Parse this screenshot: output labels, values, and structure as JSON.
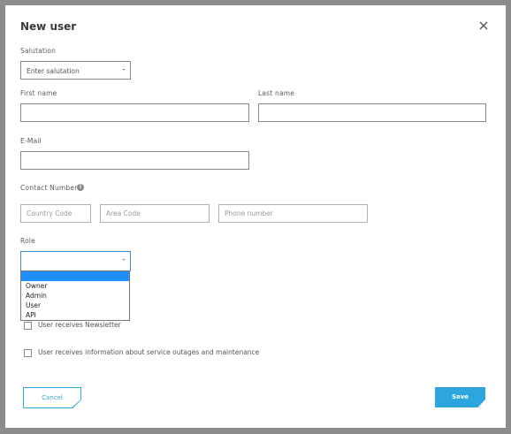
{
  "modal": {
    "title": "New user"
  },
  "salutation": {
    "label": "Salutation",
    "value": "Enter salutation"
  },
  "first_name": {
    "label": "First name",
    "value": ""
  },
  "last_name": {
    "label": "Last name",
    "value": ""
  },
  "email": {
    "label": "E-Mail",
    "value": ""
  },
  "contact": {
    "label": "Contact Number",
    "country_placeholder": "Country Code",
    "area_placeholder": "Area Code",
    "phone_placeholder": "Phone number"
  },
  "role": {
    "label": "Role",
    "value": "",
    "options": [
      "",
      "Owner",
      "Admin",
      "User",
      "API"
    ]
  },
  "checkboxes": {
    "newsletter": "User receives Newsletter",
    "outages": "User receives information about service outages and maintenance"
  },
  "buttons": {
    "cancel": "Cancel",
    "save": "Save"
  },
  "colors": {
    "accent": "#2ca6dc",
    "dropdown_highlight": "#1e90ff"
  }
}
